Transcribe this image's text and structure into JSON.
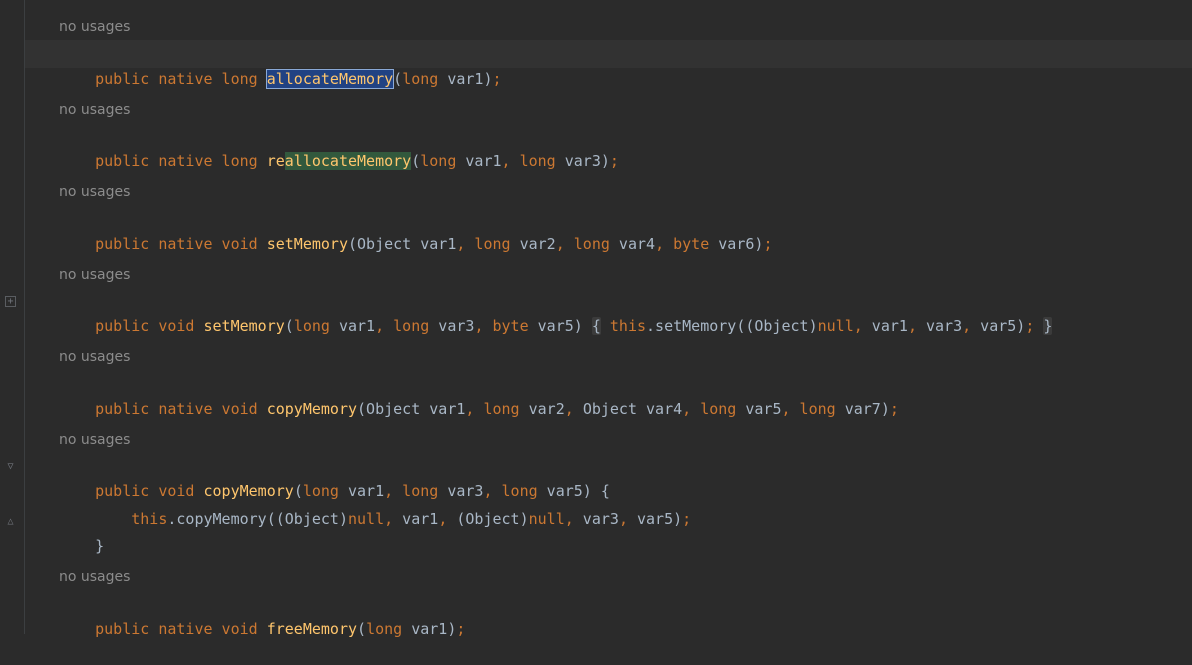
{
  "hint_text": "no usages",
  "blocks": [
    {
      "hint": "no usages",
      "line1": {
        "mod": "public native long ",
        "name": "allocateMemory",
        "args": "(long var1);"
      }
    },
    {
      "hint": "no usages",
      "line1": {
        "mod": "public native long ",
        "name_prefix": "re",
        "name": "allocateMemory",
        "args": "(long var1, long var3);"
      }
    },
    {
      "hint": "no usages",
      "line1": {
        "mod": "public native void ",
        "name": "setMemory",
        "args": "(Object var1, long var2, long var4, byte var6);"
      }
    },
    {
      "hint": "no usages",
      "line1": {
        "mod": "public void ",
        "name": "setMemory",
        "args": "(long var1, long var3, byte var5) ",
        "open": "{",
        "body_this": "this",
        "body_call": ".setMemory((Object)",
        "body_null": "null",
        "body_rest": ", var1, var3, var5);",
        "close": "}"
      }
    },
    {
      "hint": "no usages",
      "line1": {
        "mod": "public native void ",
        "name": "copyMemory",
        "args": "(Object var1, long var2, Object var4, long var5, long var7);"
      }
    },
    {
      "hint": "no usages",
      "line1": {
        "mod": "public void ",
        "name": "copyMemory",
        "args": "(long var1, long var3, long var5) {"
      },
      "line2": {
        "indent": "    ",
        "this": "this",
        "call": ".copyMemory((Object)",
        "null1": "null",
        "mid": ", var1, (Object)",
        "null2": "null",
        "rest": ", var3, var5);"
      },
      "line3": "}"
    },
    {
      "hint": "no usages",
      "line1": {
        "mod": "public native void ",
        "name": "freeMemory",
        "args": "(long var1);"
      }
    }
  ]
}
